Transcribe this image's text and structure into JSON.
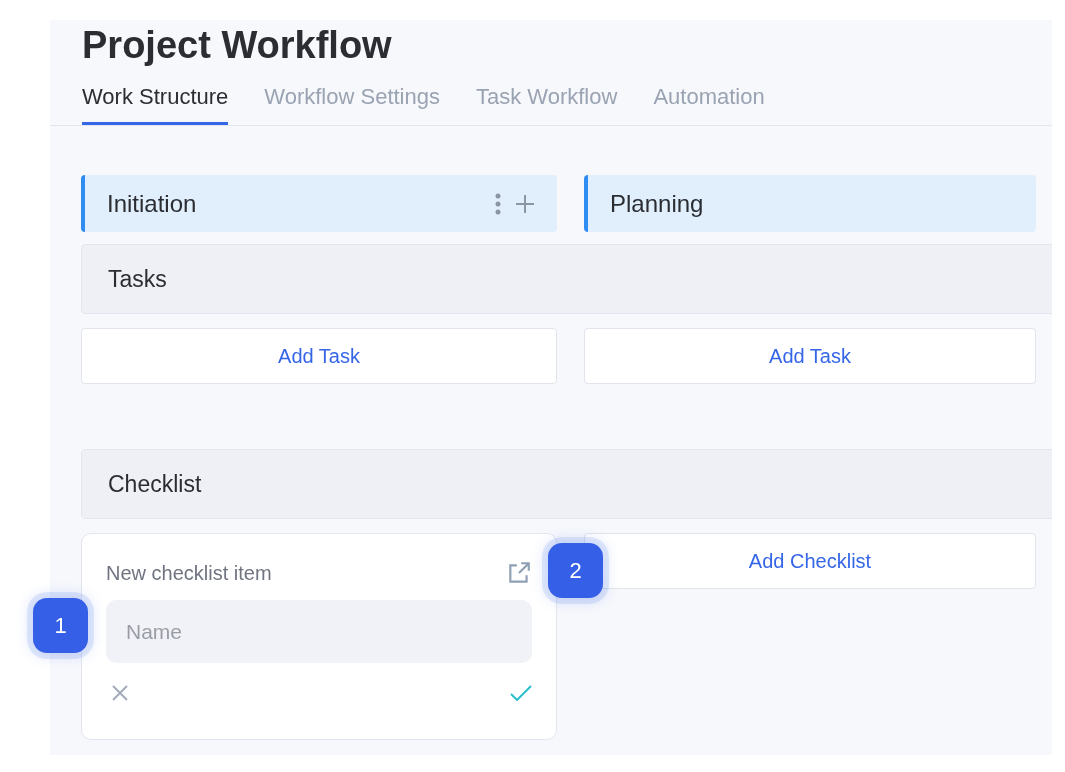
{
  "title": "Project Workflow",
  "tabs": [
    {
      "label": "Work Structure",
      "selected": true
    },
    {
      "label": "Workflow Settings",
      "selected": false
    },
    {
      "label": "Task Workflow",
      "selected": false
    },
    {
      "label": "Automation",
      "selected": false
    }
  ],
  "stages": [
    {
      "name": "Initiation",
      "show_actions": true
    },
    {
      "name": "Planning",
      "show_actions": false
    }
  ],
  "sections": [
    {
      "title": "Tasks",
      "columns": [
        {
          "kind": "button",
          "label": "Add Task"
        },
        {
          "kind": "button",
          "label": "Add Task"
        }
      ]
    },
    {
      "title": "Checklist",
      "columns": [
        {
          "kind": "form",
          "title": "New checklist item",
          "placeholder": "Name"
        },
        {
          "kind": "button",
          "label": "Add Checklist"
        }
      ]
    }
  ],
  "markers": [
    {
      "label": "1"
    },
    {
      "label": "2"
    }
  ]
}
